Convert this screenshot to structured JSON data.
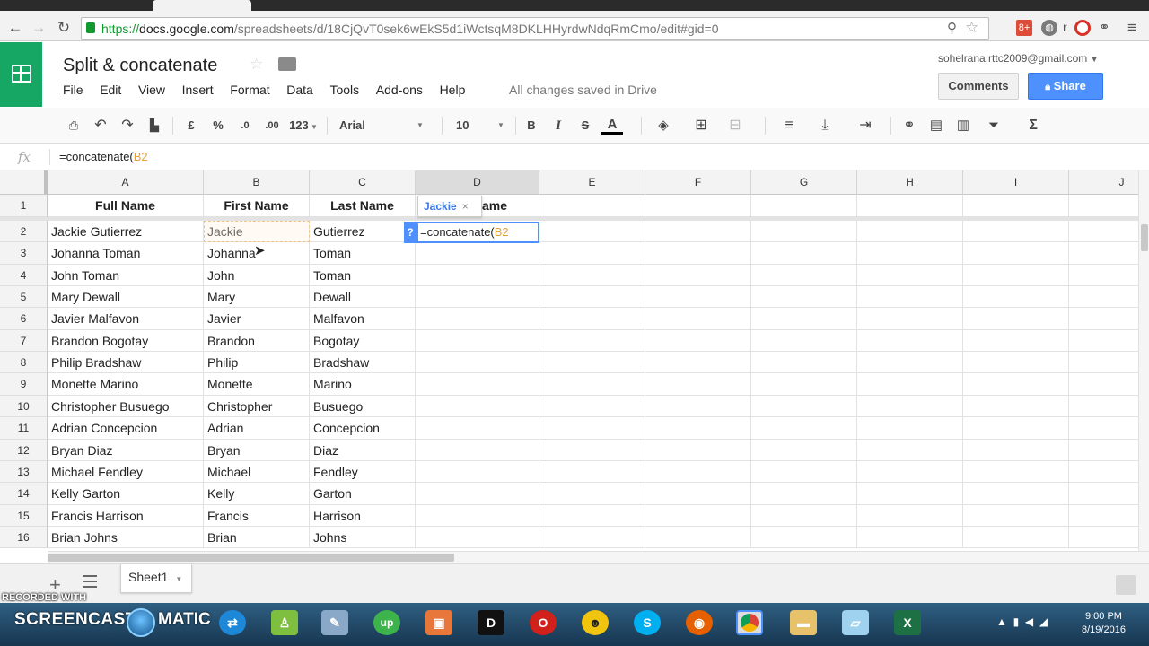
{
  "browser": {
    "url_scheme": "https://",
    "url_host": "docs.google.com",
    "url_path": "/spreadsheets/d/18CjQvT0sek6wEkS5d1iWctsqM8DKLHHyrdwNdqRmCmo/edit#gid=0",
    "ext_badge": "8+",
    "ext_r": "r"
  },
  "doc": {
    "title": "Split & concatenate",
    "account": "sohelrana.rttc2009@gmail.com",
    "saved_status": "All changes saved in Drive",
    "comments_label": "Comments",
    "share_label": "Share"
  },
  "menus": [
    "File",
    "Edit",
    "View",
    "Insert",
    "Format",
    "Data",
    "Tools",
    "Add-ons",
    "Help"
  ],
  "toolbar": {
    "currency": "£",
    "percent": "%",
    "dec_decrease": ".0",
    "dec_increase": ".00",
    "more_formats": "123",
    "font": "Arial",
    "font_size": "10",
    "bold": "B",
    "italic": "I",
    "strike": "S",
    "text_color": "A",
    "functions": "Σ"
  },
  "formula_bar": {
    "fx": "fx",
    "prefix": "=concatenate(",
    "ref": "B2"
  },
  "columns": [
    "A",
    "B",
    "C",
    "D",
    "E",
    "F",
    "G",
    "H",
    "I",
    "J"
  ],
  "headers": {
    "a": "Full Name",
    "b": "First Name",
    "c": "Last Name",
    "d_partial": "ame"
  },
  "rows": [
    {
      "n": "2",
      "a": "Jackie Gutierrez",
      "b": "Jackie",
      "c": "Gutierrez"
    },
    {
      "n": "3",
      "a": "Johanna Toman",
      "b": "Johanna",
      "c": "Toman"
    },
    {
      "n": "4",
      "a": "John Toman",
      "b": "John",
      "c": "Toman"
    },
    {
      "n": "5",
      "a": "Mary Dewall",
      "b": "Mary",
      "c": "Dewall"
    },
    {
      "n": "6",
      "a": "Javier Malfavon",
      "b": "Javier",
      "c": "Malfavon"
    },
    {
      "n": "7",
      "a": "Brandon Bogotay",
      "b": "Brandon",
      "c": "Bogotay"
    },
    {
      "n": "8",
      "a": "Philip Bradshaw",
      "b": "Philip",
      "c": "Bradshaw"
    },
    {
      "n": "9",
      "a": "Monette Marino",
      "b": "Monette",
      "c": "Marino"
    },
    {
      "n": "10",
      "a": "Christopher Busuego",
      "b": "Christopher",
      "c": "Busuego"
    },
    {
      "n": "11",
      "a": "Adrian Concepcion",
      "b": "Adrian",
      "c": "Concepcion"
    },
    {
      "n": "12",
      "a": "Bryan Diaz",
      "b": "Bryan",
      "c": "Diaz"
    },
    {
      "n": "13",
      "a": "Michael Fendley",
      "b": "Michael",
      "c": "Fendley"
    },
    {
      "n": "14",
      "a": "Kelly Garton",
      "b": "Kelly",
      "c": "Garton"
    },
    {
      "n": "15",
      "a": "Francis Harrison",
      "b": "Francis",
      "c": "Harrison"
    },
    {
      "n": "16",
      "a": "Brian Johns",
      "b": "Brian",
      "c": "Johns"
    }
  ],
  "header_row_num": "1",
  "editor": {
    "hint_value": "Jackie",
    "hint_close": "×",
    "help": "?",
    "prefix": "=concatenate(",
    "ref": "B2"
  },
  "sheet": {
    "tab_label": "Sheet1",
    "add": "+"
  },
  "watermark": "RECORDED WITH",
  "taskbar": {
    "screencast": "SCREENCAST",
    "matic": "MATIC",
    "time": "9:00 PM",
    "date": "8/19/2016"
  },
  "colors": {
    "sheets_green": "#16a765",
    "share_blue": "#4d90fe",
    "selection_blue": "#4d90fe",
    "reference_orange": "#e6a23c"
  }
}
